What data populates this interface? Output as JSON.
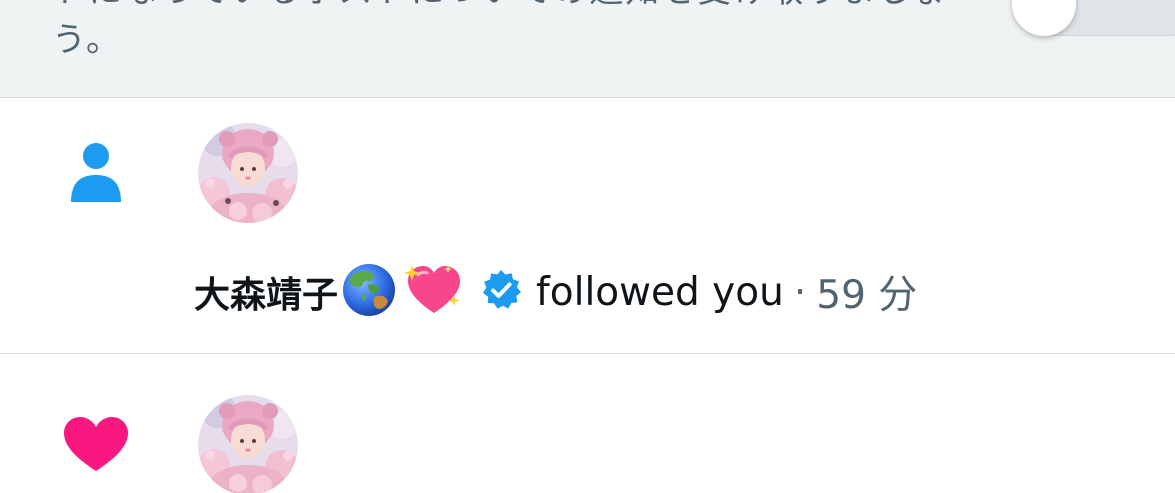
{
  "banner": {
    "text": "トになっているポストについての通知を受け取りましょう。"
  },
  "notifications": [
    {
      "type_icon": "person-icon",
      "accent_color": "#1d9bf0",
      "user": {
        "display_name": "大森靖子",
        "emojis": [
          "globe-asia-australia-emoji",
          "sparkling-heart-emoji"
        ],
        "verified": true
      },
      "action": "followed you",
      "separator": "·",
      "time": "59 分"
    },
    {
      "type_icon": "heart-icon",
      "accent_color": "#f91880"
    }
  ]
}
